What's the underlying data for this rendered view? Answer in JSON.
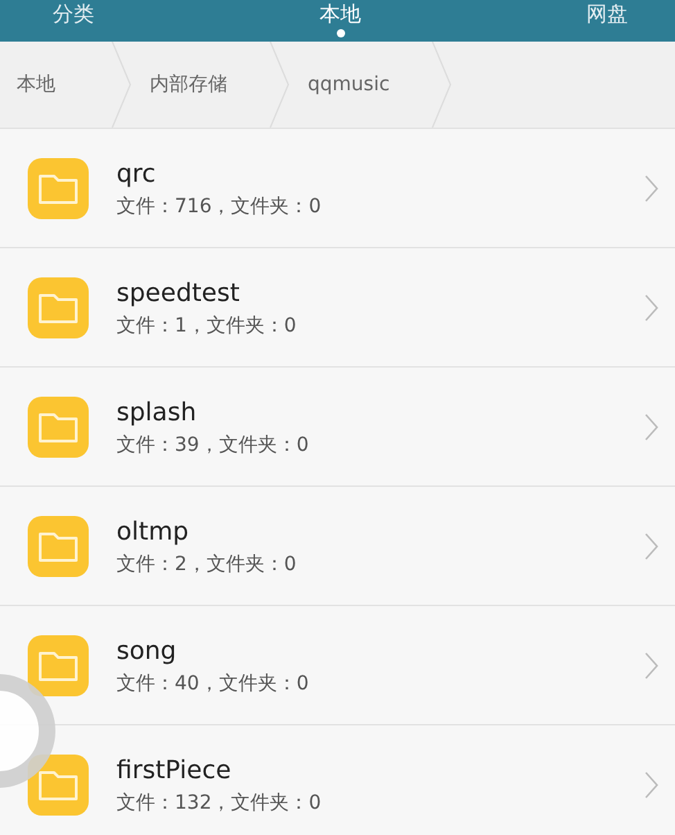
{
  "tabs": [
    {
      "label": "分类",
      "selected": false
    },
    {
      "label": "本地",
      "selected": true
    },
    {
      "label": "网盘",
      "selected": false
    }
  ],
  "breadcrumbs": [
    "本地",
    "内部存储",
    "qqmusic"
  ],
  "folders": [
    {
      "name": "qrc",
      "detail": "文件：716，文件夹：0"
    },
    {
      "name": "speedtest",
      "detail": "文件：1，文件夹：0"
    },
    {
      "name": "splash",
      "detail": "文件：39，文件夹：0"
    },
    {
      "name": "oltmp",
      "detail": "文件：2，文件夹：0"
    },
    {
      "name": "song",
      "detail": "文件：40，文件夹：0"
    },
    {
      "name": "firstPiece",
      "detail": "文件：132，文件夹：0"
    }
  ]
}
